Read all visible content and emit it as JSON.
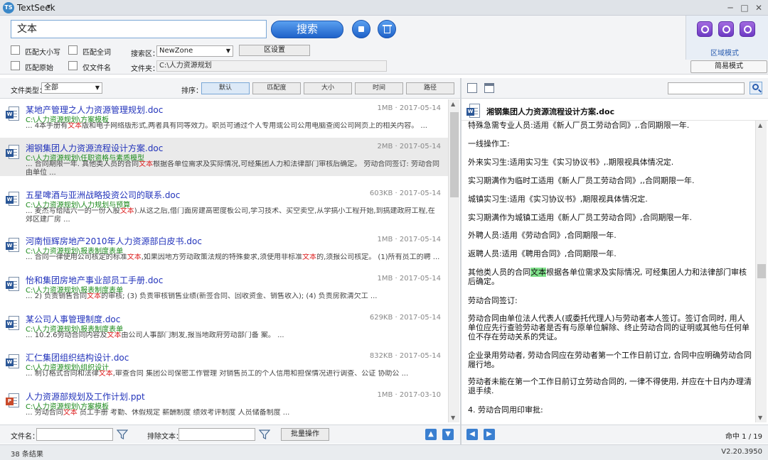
{
  "app": {
    "title": "TextSeek",
    "logo": "TS"
  },
  "search": {
    "query": "文本",
    "button_label": "搜索",
    "options": {
      "match_case": "匹配大小写",
      "match_whole_word": "匹配全词",
      "match_original": "匹配原始",
      "filename_only": "仅文件名"
    },
    "area_label": "搜索区：",
    "area_value": "NewZone",
    "area_settings_label": "区设置",
    "folder_label": "文件夹：",
    "folder_value": "C:\\人力资源规划"
  },
  "tool_panel": {
    "area_mode": "区域模式",
    "simple_mode": "简易模式"
  },
  "filter": {
    "filetype_label": "文件类型：",
    "filetype_value": "全部",
    "sort_label": "排序：",
    "sort_options": [
      "默认",
      "匹配度",
      "大小",
      "时间",
      "路径"
    ]
  },
  "results": [
    {
      "title": "某地产管理之人力资源管理规划.doc",
      "meta": "1MB · 2017-05-14",
      "path": "C:\\人力资源规划\\方案模板",
      "pre": "... 4本手册有",
      "hit": "文本",
      "post": "版和电子网络版形式,两者具有同等效力。职员可通过个人专用或公司公用电脑查阅公司网页上的相关内容。 ...",
      "icon": "doc"
    },
    {
      "title": "湘钢集团人力资源流程设计方案.doc",
      "meta": "2MB · 2017-05-14",
      "path": "C:\\人力资源规划\\任职资格与素质模型",
      "pre": "... 合同期限一年. 其他类人员的合同",
      "hit": "文本",
      "post": "根据各单位需求及实际情况,可经集团人力和法律部门审核后确定。 劳动合同签订: 劳动合同由单位 ...",
      "icon": "doc"
    },
    {
      "title": "五星啤酒与亚洲战略投资公司的联系.doc",
      "meta": "603KB · 2017-05-14",
      "path": "C:\\人力资源规划\\人力规划与预算",
      "pre": "... 麦杰写给陆六一的一份入股",
      "hit": "文本",
      "post": ").从这之后,借门面房建高密度板公司,学习技术、买空卖空,从学搞小工程开始,到搞建政府工程,在郊区建厂房 ...",
      "icon": "doc"
    },
    {
      "title": "河南恒辉房地产2010年人力资源部白皮书.doc",
      "meta": "1MB · 2017-05-14",
      "path": "C:\\人力资源规划\\报表制度表单",
      "pre": "... 合同一律使用公司核定的标准",
      "hit": "文本",
      "post": ",如果因地方劳动政策法规的特殊要求,须使用非标准",
      "hit2": "文本",
      "post2": "的,须报公司核定。 (1)所有员工的聘 ...",
      "icon": "doc"
    },
    {
      "title": "怡和集团房地产事业部员工手册.doc",
      "meta": "1MB · 2017-05-14",
      "path": "C:\\人力资源规划\\报表制度表单",
      "pre": "... 2) 负责销售合同",
      "hit": "文本",
      "post": "的审核; (3) 负责审核销售业绩(新签合同、回收资金、销售收入); (4) 负责房款清欠工 ...",
      "icon": "doc"
    },
    {
      "title": "某公司人事管理制度.doc",
      "meta": "629KB · 2017-05-14",
      "path": "C:\\人力资源规划\\报表制度表单",
      "pre": "... 10.2.6劳动合同内容及",
      "hit": "文本",
      "post": "由公司人事部门制发,报当地政府劳动部门备 案。 ...",
      "icon": "doc"
    },
    {
      "title": "汇仁集团组织结构设计.doc",
      "meta": "832KB · 2017-05-14",
      "path": "C:\\人力资源规划\\组织设计",
      "pre": "... 制订格式合同和法律",
      "hit": "文本",
      "post": ",审查合同 集团公司保密工作管理 对销售员工的个人信用和担保情况进行调查、公证 协助公 ...",
      "icon": "doc"
    },
    {
      "title": "人力资源部规划及工作计划.ppt",
      "meta": "1MB · 2017-03-10",
      "path": "C:\\人力资源规划\\方案模板",
      "pre": "... 劳动合同",
      "hit": "文本",
      "post": " 员工手册 考勤、休假规定 薪酬制度 绩效考评制度 人员储备制度 ...",
      "icon": "ppt"
    }
  ],
  "bottom": {
    "filename_label": "文件名：",
    "exclude_label": "排除文本：",
    "batch_label": "批量操作"
  },
  "status": {
    "count": "38 条结果",
    "version": "V2.20.3950"
  },
  "preview": {
    "title": "湘钢集团人力资源流程设计方案.doc",
    "paragraphs": [
      {
        "text": "特殊急需专业人员:适用《新人厂员工劳动合同》,.合同期限一年."
      },
      {
        "text": "一线操作工:"
      },
      {
        "text": "外来实习生:适用实习生《实习协议书》,.期限视具体情况定."
      },
      {
        "text": "实习期满作为临时工适用《新人厂员工劳动合同》,,合同期限一年."
      },
      {
        "text": "城镇实习生:适用《实习协议书》,期限视具体情况定."
      },
      {
        "text": "实习期满作为城镇工适用《新人厂员工劳动合同》,合同期限一年."
      },
      {
        "text": "外聘人员:适用《劳动合同》,合同期限一年."
      },
      {
        "text": "返聘人员:适用《聘用合同》,合同期限一年."
      },
      {
        "pre": "其他类人员的合同",
        "hit": "文本",
        "post": "根据各单位需求及实际情况, 可经集团人力和法律部门审核后确定。"
      },
      {
        "text": "劳动合同签订:"
      },
      {
        "text": "劳动合同由单位法人代表人(或委托代理人)与劳动者本人签订。签订合同时, 用人单位应先行查验劳动者是否有与原单位解除、终止劳动合同的证明或其他与任何单位不存在劳动关系的凭证。"
      },
      {
        "text": "企业录用劳动者, 劳动合同应在劳动者第一个工作日前订立, 合同中应明确劳动合同履行地。"
      },
      {
        "text": "劳动者未能在第一个工作日前订立劳动合同的, 一律不得使用, 并应在十日内办理清退手续."
      },
      {
        "text": "4. 劳动合同用印审批:"
      }
    ],
    "hit_counter": "命中 1 / 19"
  }
}
